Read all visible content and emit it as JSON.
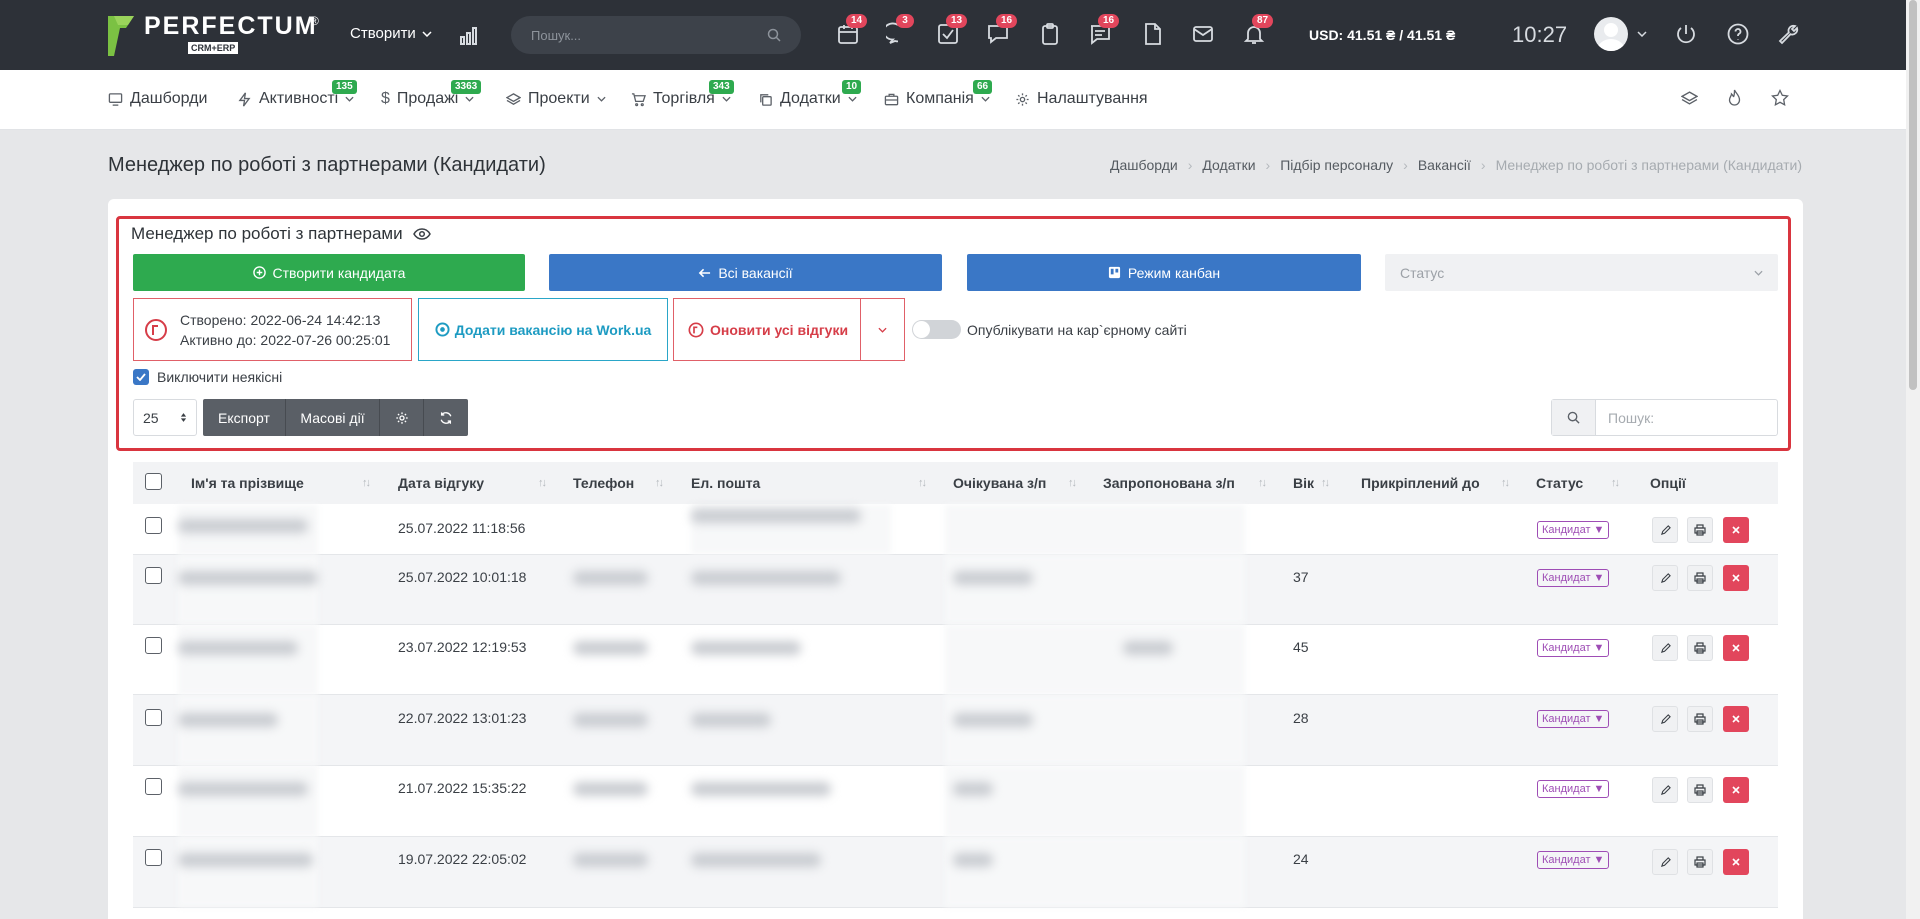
{
  "topbar": {
    "logo_word": "PERFECTUM",
    "logo_reg": "®",
    "logo_sub": "CRM+ERP",
    "create_label": "Створити",
    "search_placeholder": "Пошук...",
    "badges": {
      "b1": "14",
      "b2": "3",
      "b3": "13",
      "b4": "16",
      "b6": "16",
      "b9": "87"
    },
    "currency": "USD: 41.51 ₴ / 41.51 ₴",
    "time": "10:27"
  },
  "nav": {
    "dashboards": "Дашборди",
    "activities": "Активності",
    "activities_badge": "135",
    "sales": "Продажі",
    "sales_badge": "3363",
    "projects": "Проекти",
    "trade": "Торгівля",
    "trade_badge": "343",
    "apps": "Додатки",
    "apps_badge": "10",
    "company": "Компанія",
    "company_badge": "66",
    "settings": "Налаштування"
  },
  "page": {
    "title": "Менеджер по роботі з партнерами (Кандидати)",
    "breadcrumbs": [
      "Дашборди",
      "Додатки",
      "Підбір персоналу",
      "Вакансії",
      "Менеджер по роботі з партнерами (Кандидати)"
    ]
  },
  "vacancy": {
    "title": "Менеджер по роботі з партнерами",
    "create_candidate": "Створити кандидата",
    "all_vacancies": "Всі вакансії",
    "kanban": "Режим канбан",
    "status_placeholder": "Статус",
    "created": "Створено: 2022-06-24 14:42:13",
    "active_until": "Активно до: 2022-07-26 00:25:01",
    "add_work": "Додати вакансію на Work.ua",
    "update_responses": "Оновити усі відгуки",
    "publish_label": "Опублікувати на кар`єрному сайті",
    "exclude_label": "Виключити неякісні",
    "per_page": "25",
    "export": "Експорт",
    "mass_actions": "Масові дії",
    "table_search_placeholder": "Пошук:"
  },
  "table": {
    "headers": [
      "Ім'я та прізвище",
      "Дата відгуку",
      "Телефон",
      "Ел. пошта",
      "Очікувана з/п",
      "Запропонована з/п",
      "Вік",
      "Прикріплений до",
      "Статус",
      "Опції"
    ],
    "status_label": "Кандидат",
    "rows": [
      {
        "date": "25.07.2022 11:18:56",
        "age": ""
      },
      {
        "date": "25.07.2022 10:01:18",
        "age": "37"
      },
      {
        "date": "23.07.2022 12:19:53",
        "age": "45"
      },
      {
        "date": "22.07.2022 13:01:23",
        "age": "28"
      },
      {
        "date": "21.07.2022 15:35:22",
        "age": ""
      },
      {
        "date": "19.07.2022 22:05:02",
        "age": "24"
      }
    ]
  },
  "colors": {
    "green": "#2eaa4f",
    "blue": "#3a77c6",
    "red": "#d9353f",
    "dark": "#2d3138"
  }
}
